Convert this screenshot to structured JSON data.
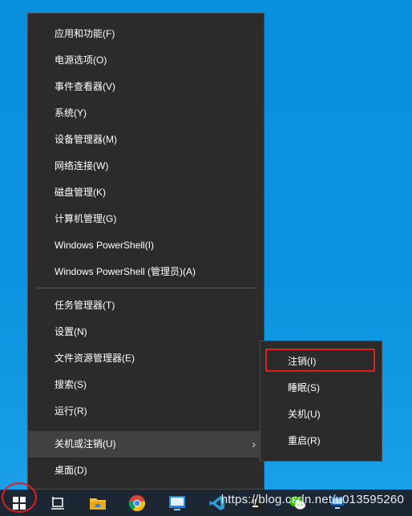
{
  "context_menu": {
    "items": [
      {
        "label": "应用和功能(F)"
      },
      {
        "label": "电源选项(O)"
      },
      {
        "label": "事件查看器(V)"
      },
      {
        "label": "系统(Y)"
      },
      {
        "label": "设备管理器(M)"
      },
      {
        "label": "网络连接(W)"
      },
      {
        "label": "磁盘管理(K)"
      },
      {
        "label": "计算机管理(G)"
      },
      {
        "label": "Windows PowerShell(I)"
      },
      {
        "label": "Windows PowerShell (管理员)(A)"
      },
      {
        "label": "任务管理器(T)"
      },
      {
        "label": "设置(N)"
      },
      {
        "label": "文件资源管理器(E)"
      },
      {
        "label": "搜索(S)"
      },
      {
        "label": "运行(R)"
      },
      {
        "label": "关机或注销(U)"
      },
      {
        "label": "桌面(D)"
      }
    ]
  },
  "submenu": {
    "items": [
      {
        "label": "注销(I)"
      },
      {
        "label": "睡眠(S)"
      },
      {
        "label": "关机(U)"
      },
      {
        "label": "重启(R)"
      }
    ]
  },
  "taskbar": {
    "icons": [
      "windows-start-icon",
      "task-view-icon",
      "file-explorer-icon",
      "chrome-icon",
      "app-icon",
      "vscode-icon",
      "ide-icon",
      "wechat-icon",
      "remote-desktop-icon"
    ]
  },
  "watermark": "https://blog.csdn.net/u013595260",
  "colors": {
    "menu_bg": "#2b2b2b",
    "hover_bg": "#414141",
    "highlight_border": "#e31e1e",
    "desktop": "#0c93df",
    "taskbar": "#1c2733"
  }
}
